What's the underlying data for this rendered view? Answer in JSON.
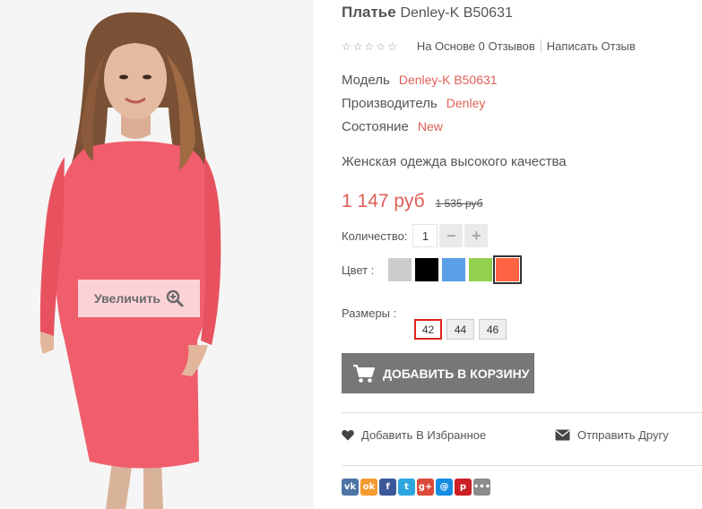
{
  "product": {
    "name": "Платье",
    "model_short": "Denley-K B50631",
    "zoom_label": "Увеличить"
  },
  "rating": {
    "stars": 5,
    "reviews_label": "На Основе 0 Отзывов",
    "write_review_label": "Написать Отзыв"
  },
  "specs": [
    {
      "label": "Модель",
      "value": "Denley-K B50631"
    },
    {
      "label": "Производитель",
      "value": "Denley"
    },
    {
      "label": "Состояние",
      "value": "New"
    }
  ],
  "description": "Женская одежда высокого качества",
  "price": {
    "current": "1 147 руб",
    "old": "1 535 руб"
  },
  "quantity": {
    "label": "Количество:",
    "value": "1",
    "minus": "−",
    "plus": "+"
  },
  "colors": {
    "label": "Цвет :",
    "swatches": [
      "#cccccc",
      "#000000",
      "#5c9ee8",
      "#92d050",
      "#ff6342"
    ],
    "selected_index": 4
  },
  "sizes": {
    "label": "Размеры :",
    "options": [
      "42",
      "44",
      "46"
    ],
    "selected": "42"
  },
  "cart_button": "ДОБАВИТЬ В КОРЗИНУ",
  "actions": {
    "wishlist": "Добавить В Избранное",
    "send_friend": "Отправить Другу"
  },
  "share": [
    {
      "name": "vk-icon",
      "glyph": "vk",
      "color": "#4c75a3"
    },
    {
      "name": "odnoklassniki-icon",
      "glyph": "ok",
      "color": "#f59a2f"
    },
    {
      "name": "facebook-icon",
      "glyph": "f",
      "color": "#3b5998"
    },
    {
      "name": "twitter-icon",
      "glyph": "t",
      "color": "#2ea7e0"
    },
    {
      "name": "google-plus-icon",
      "glyph": "g+",
      "color": "#db4a39"
    },
    {
      "name": "mail-icon",
      "glyph": "@",
      "color": "#168de2"
    },
    {
      "name": "pinterest-icon",
      "glyph": "p",
      "color": "#cb2027"
    },
    {
      "name": "more-icon",
      "glyph": "•••",
      "color": "#8c8c8c"
    }
  ],
  "accent_color": "#e05f56"
}
